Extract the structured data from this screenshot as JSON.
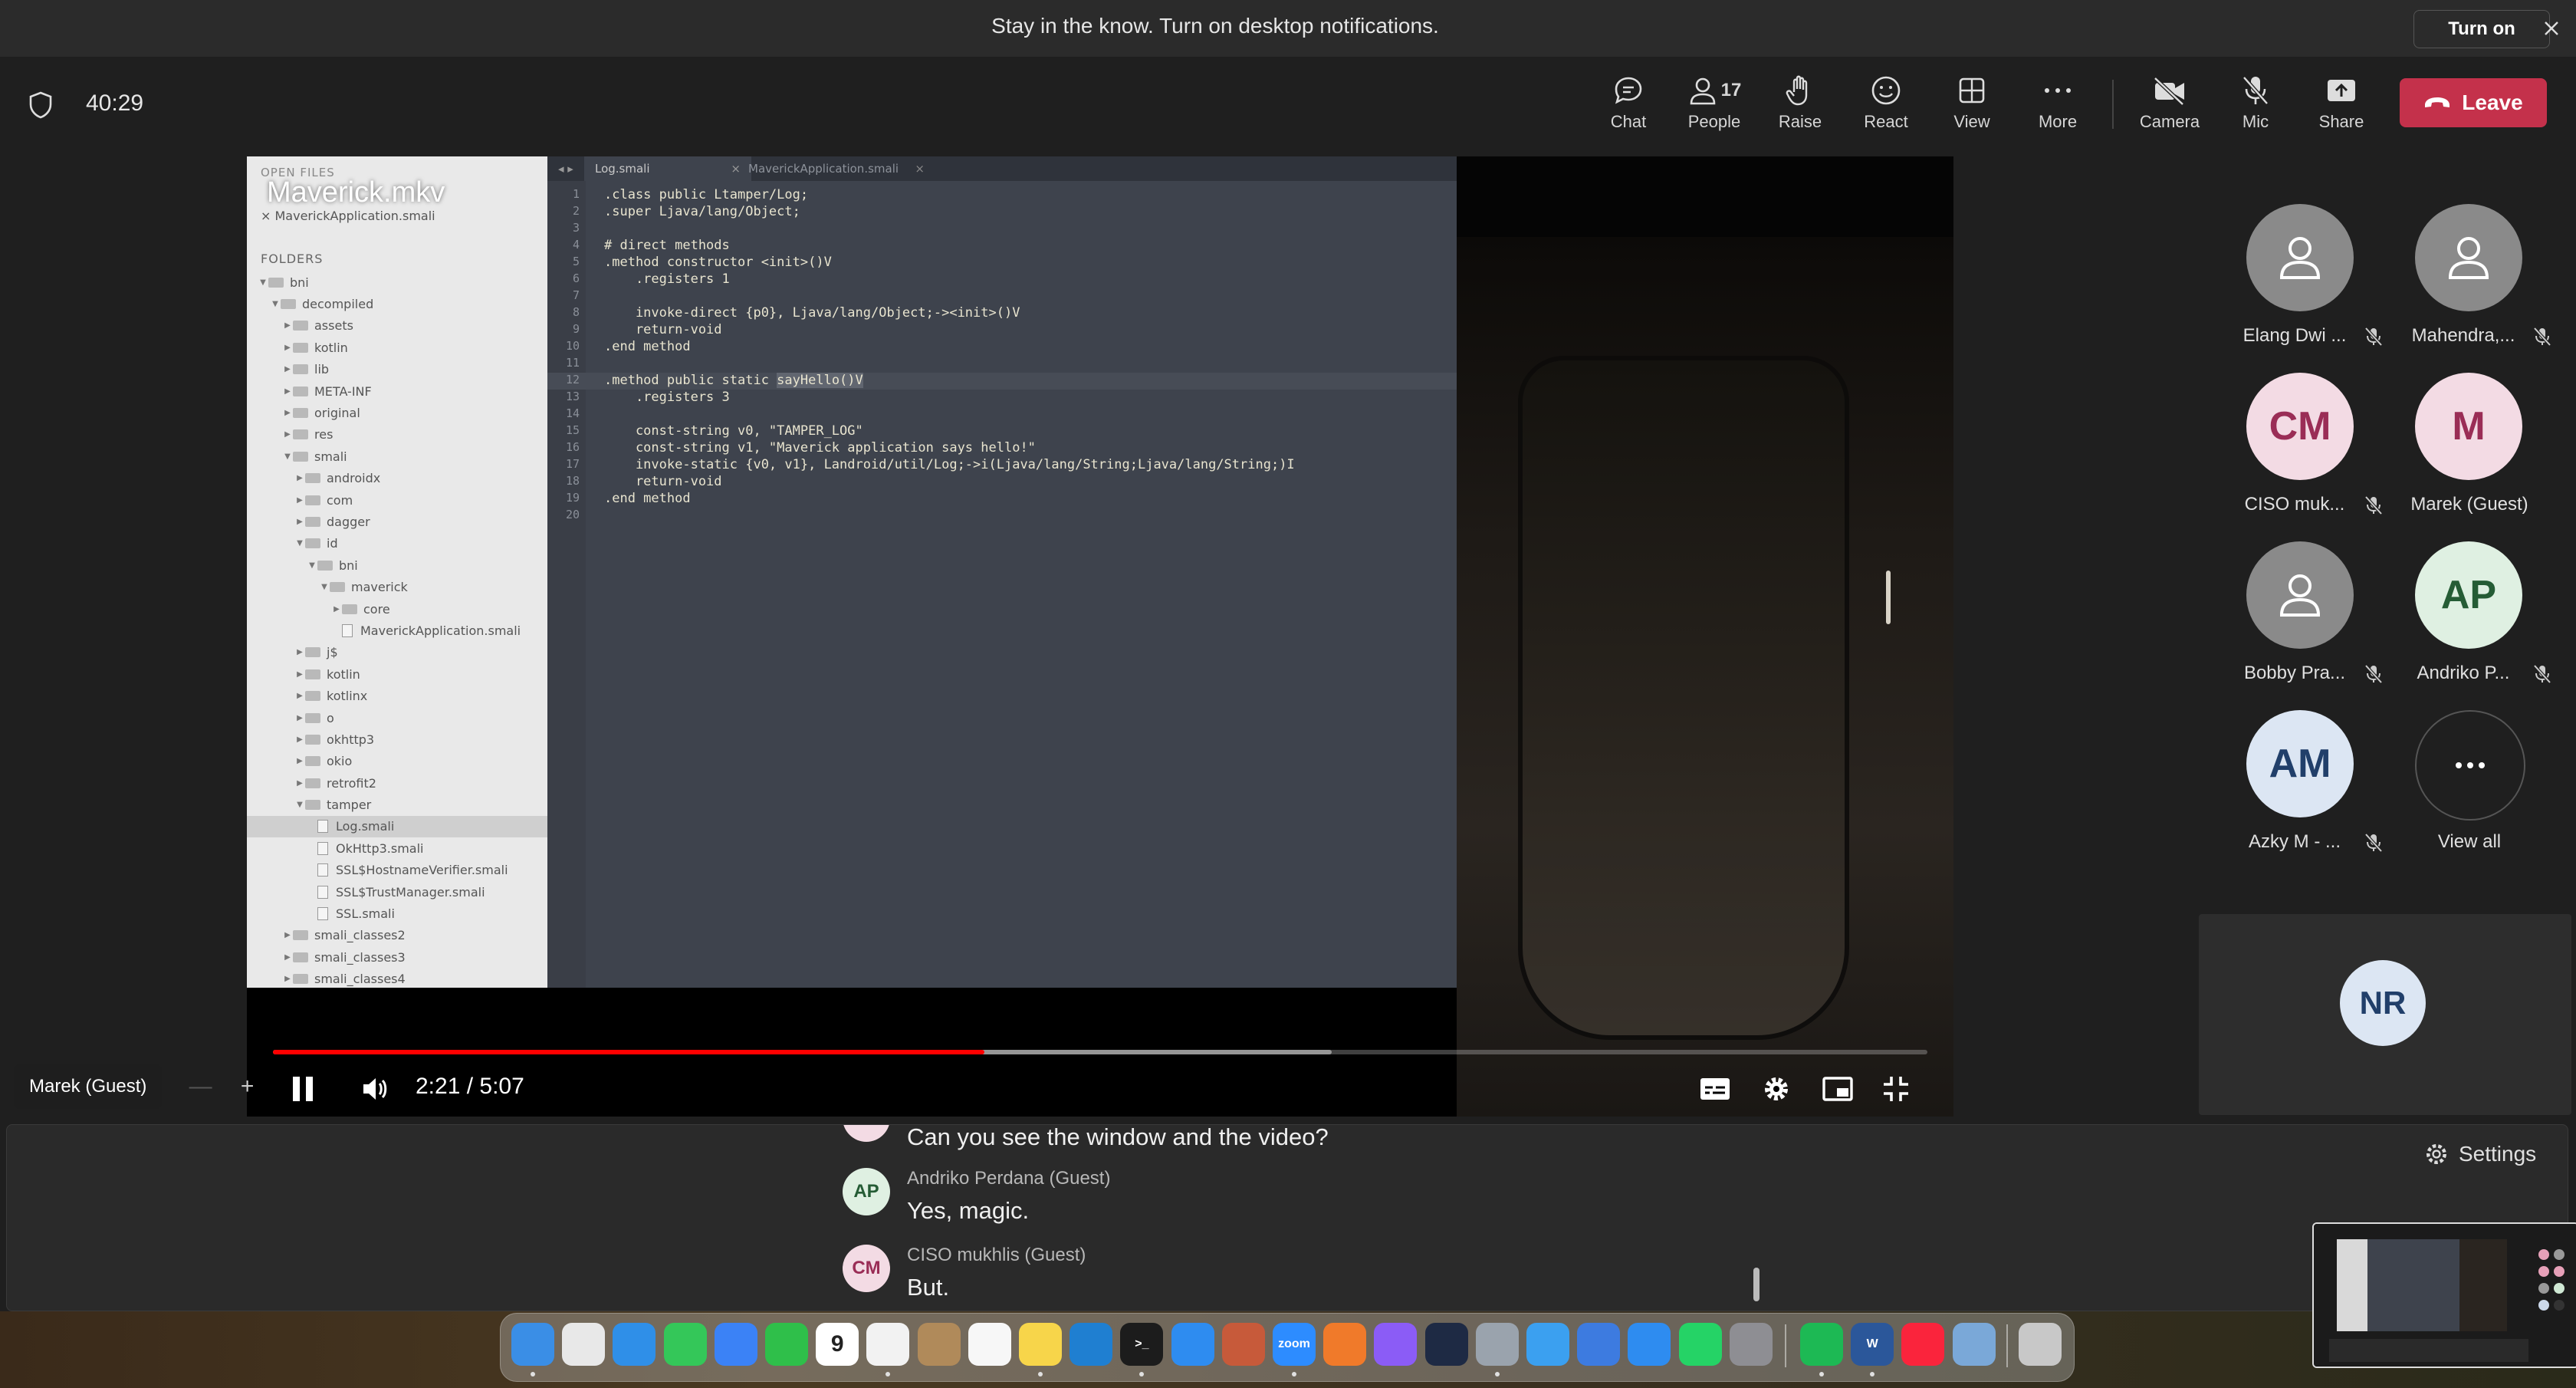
{
  "notification": {
    "text": "Stay in the know. Turn on desktop notifications.",
    "turn_on_label": "Turn on"
  },
  "meeting": {
    "timer": "40:29",
    "toolbar": {
      "chat": "Chat",
      "people": "People",
      "people_count": "17",
      "raise": "Raise",
      "react": "React",
      "view": "View",
      "more": "More",
      "camera": "Camera",
      "mic": "Mic",
      "share": "Share",
      "leave": "Leave"
    }
  },
  "video": {
    "title": "Maverick.mkv",
    "current_time": "2:21 / 5:07",
    "progress_played": 0.43,
    "progress_buffered": 0.64,
    "editor": {
      "open_files_label": "OPEN FILES",
      "open_file": "× MaverickApplication.smali",
      "folders_label": "FOLDERS",
      "tabs": [
        "Log.smali",
        "MaverickApplication.smali"
      ],
      "tree": [
        {
          "name": "bni",
          "depth": 0,
          "type": "folder",
          "open": true
        },
        {
          "name": "decompiled",
          "depth": 1,
          "type": "folder",
          "open": true
        },
        {
          "name": "assets",
          "depth": 2,
          "type": "folder"
        },
        {
          "name": "kotlin",
          "depth": 2,
          "type": "folder"
        },
        {
          "name": "lib",
          "depth": 2,
          "type": "folder"
        },
        {
          "name": "META-INF",
          "depth": 2,
          "type": "folder"
        },
        {
          "name": "original",
          "depth": 2,
          "type": "folder"
        },
        {
          "name": "res",
          "depth": 2,
          "type": "folder"
        },
        {
          "name": "smali",
          "depth": 2,
          "type": "folder",
          "open": true
        },
        {
          "name": "androidx",
          "depth": 3,
          "type": "folder"
        },
        {
          "name": "com",
          "depth": 3,
          "type": "folder"
        },
        {
          "name": "dagger",
          "depth": 3,
          "type": "folder"
        },
        {
          "name": "id",
          "depth": 3,
          "type": "folder",
          "open": true
        },
        {
          "name": "bni",
          "depth": 4,
          "type": "folder",
          "open": true
        },
        {
          "name": "maverick",
          "depth": 5,
          "type": "folder",
          "open": true
        },
        {
          "name": "core",
          "depth": 6,
          "type": "folder"
        },
        {
          "name": "MaverickApplication.smali",
          "depth": 6,
          "type": "file"
        },
        {
          "name": "j$",
          "depth": 3,
          "type": "folder"
        },
        {
          "name": "kotlin",
          "depth": 3,
          "type": "folder"
        },
        {
          "name": "kotlinx",
          "depth": 3,
          "type": "folder"
        },
        {
          "name": "o",
          "depth": 3,
          "type": "folder"
        },
        {
          "name": "okhttp3",
          "depth": 3,
          "type": "folder"
        },
        {
          "name": "okio",
          "depth": 3,
          "type": "folder"
        },
        {
          "name": "retrofit2",
          "depth": 3,
          "type": "folder"
        },
        {
          "name": "tamper",
          "depth": 3,
          "type": "folder",
          "open": true
        },
        {
          "name": "Log.smali",
          "depth": 4,
          "type": "file",
          "selected": true
        },
        {
          "name": "OkHttp3.smali",
          "depth": 4,
          "type": "file"
        },
        {
          "name": "SSL$HostnameVerifier.smali",
          "depth": 4,
          "type": "file"
        },
        {
          "name": "SSL$TrustManager.smali",
          "depth": 4,
          "type": "file"
        },
        {
          "name": "SSL.smali",
          "depth": 4,
          "type": "file"
        },
        {
          "name": "smali_classes2",
          "depth": 2,
          "type": "folder"
        },
        {
          "name": "smali_classes3",
          "depth": 2,
          "type": "folder"
        },
        {
          "name": "smali_classes4",
          "depth": 2,
          "type": "folder"
        }
      ],
      "code_lines": [
        ".class public Ltamper/Log;",
        ".super Ljava/lang/Object;",
        "",
        "# direct methods",
        ".method constructor <init>()V",
        "    .registers 1",
        "",
        "    invoke-direct {p0}, Ljava/lang/Object;-><init>()V",
        "    return-void",
        ".end method",
        "",
        ".method public static sayHello()V",
        "    .registers 3",
        "",
        "    const-string v0, \"TAMPER_LOG\"",
        "    const-string v1, \"Maverick application says hello!\"",
        "    invoke-static {v0, v1}, Landroid/util/Log;->i(Ljava/lang/String;Ljava/lang/String;)I",
        "    return-void",
        ".end method",
        ""
      ],
      "current_line": 12
    }
  },
  "speaker": {
    "name": "Marek (Guest)",
    "zoom_minus": "—",
    "zoom_plus": "+"
  },
  "participants": [
    {
      "name": "Elang Dwi ...",
      "initials": "",
      "style": "grey",
      "muted": true
    },
    {
      "name": "Mahendra,...",
      "initials": "",
      "style": "grey",
      "muted": true
    },
    {
      "name": "CISO muk...",
      "initials": "CM",
      "style": "pink",
      "muted": true
    },
    {
      "name": "Marek (Guest)",
      "initials": "M",
      "style": "pink",
      "muted": false
    },
    {
      "name": "Bobby Pra...",
      "initials": "",
      "style": "grey",
      "muted": true
    },
    {
      "name": "Andriko P...",
      "initials": "AP",
      "style": "green",
      "muted": true
    },
    {
      "name": "Azky M - ...",
      "initials": "AM",
      "style": "blue",
      "muted": true
    },
    {
      "name": "View all",
      "initials": "",
      "style": "more",
      "muted": false
    }
  ],
  "self_tile": {
    "initials": "NR"
  },
  "chat": {
    "settings_label": "Settings",
    "messages": [
      {
        "initials": "",
        "avatar_style": "pink",
        "sender": "",
        "text": "Can you see the window and the video?"
      },
      {
        "initials": "AP",
        "avatar_style": "green",
        "sender": "Andriko Perdana (Guest)",
        "text": "Yes, magic."
      },
      {
        "initials": "CM",
        "avatar_style": "pink",
        "sender": "CISO mukhlis (Guest)",
        "text": "But."
      }
    ]
  },
  "dock": {
    "apps": [
      {
        "name": "finder",
        "color": "#3a8ee6",
        "label": ""
      },
      {
        "name": "launchpad",
        "color": "#e8e8e8",
        "label": ""
      },
      {
        "name": "safari",
        "color": "#2f8fe8",
        "label": ""
      },
      {
        "name": "messages",
        "color": "#34c759",
        "label": ""
      },
      {
        "name": "mail",
        "color": "#3b82f6",
        "label": ""
      },
      {
        "name": "facetime",
        "color": "#2fbf4a",
        "label": ""
      },
      {
        "name": "calendar",
        "color": "#ffffff",
        "label": "9"
      },
      {
        "name": "chrome",
        "color": "#f2f2f2",
        "label": ""
      },
      {
        "name": "contacts",
        "color": "#b08a5a",
        "label": ""
      },
      {
        "name": "reminders",
        "color": "#f7f7f7",
        "label": ""
      },
      {
        "name": "notes",
        "color": "#f7d54a",
        "label": ""
      },
      {
        "name": "vscode",
        "color": "#1f7fd1",
        "label": ""
      },
      {
        "name": "terminal",
        "color": "#1c1c1c",
        "label": ">_"
      },
      {
        "name": "app-store",
        "color": "#2e8cf0",
        "label": ""
      },
      {
        "name": "photo-app",
        "color": "#c75a3a",
        "label": ""
      },
      {
        "name": "zoom",
        "color": "#2d8cff",
        "label": "zoom"
      },
      {
        "name": "pencil-app",
        "color": "#f07a2a",
        "label": ""
      },
      {
        "name": "podcast-app",
        "color": "#8b5cf6",
        "label": ""
      },
      {
        "name": "vpn-app",
        "color": "#1e2a44",
        "label": ""
      },
      {
        "name": "settings-app",
        "color": "#9aa3ad",
        "label": ""
      },
      {
        "name": "testflight",
        "color": "#3ba0f0",
        "label": ""
      },
      {
        "name": "xcode",
        "color": "#3d7be0",
        "label": ""
      },
      {
        "name": "app-store-2",
        "color": "#2e8cf0",
        "label": ""
      },
      {
        "name": "whatsapp",
        "color": "#25d366",
        "label": ""
      },
      {
        "name": "system-preferences",
        "color": "#8e8e93",
        "label": ""
      },
      {
        "name": "spotify",
        "color": "#1db954",
        "label": ""
      },
      {
        "name": "word",
        "color": "#2b579a",
        "label": "W"
      },
      {
        "name": "music",
        "color": "#fa243c",
        "label": ""
      },
      {
        "name": "preview",
        "color": "#7aa8d8",
        "label": ""
      },
      {
        "name": "trash",
        "color": "#c8c8c8",
        "label": ""
      }
    ]
  }
}
